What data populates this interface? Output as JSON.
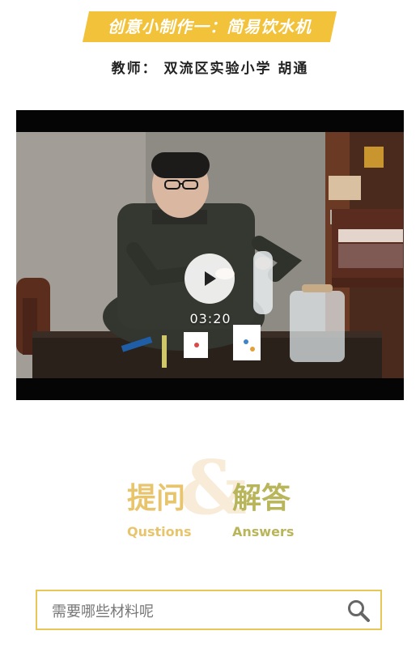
{
  "header": {
    "title": "创意小制作一：简易饮水机",
    "teacher": "教师：  双流区实验小学   胡通"
  },
  "video": {
    "duration": "03:20",
    "play_icon": "play-icon"
  },
  "qa": {
    "left_cn": "提问",
    "left_en": "Qustions",
    "right_cn": "解答",
    "right_en": "Answers",
    "ampersand": "&"
  },
  "search": {
    "placeholder": "需要哪些材料呢",
    "icon": "search-icon"
  },
  "colors": {
    "banner": "#f2c23a",
    "search_border": "#e9c757",
    "qa_left": "#e8c56d",
    "qa_right": "#b9b55a"
  }
}
